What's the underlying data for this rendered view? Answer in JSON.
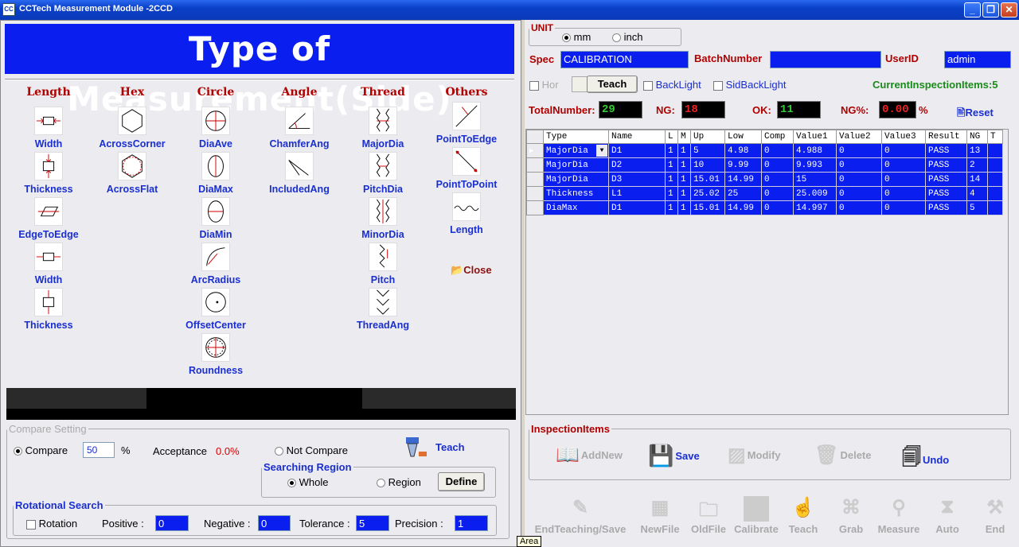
{
  "window": {
    "title": "CCTech Measurement Module -2CCD",
    "logo": "CC",
    "min": "_",
    "max": "❐",
    "close": "✕"
  },
  "banner": "Type of Measurement(Side)",
  "columns": {
    "length": {
      "head": "Length",
      "items": [
        "Width",
        "Thickness",
        "EdgeToEdge",
        "Width",
        "Thickness"
      ]
    },
    "hex": {
      "head": "Hex",
      "items": [
        "AcrossCorner",
        "AcrossFlat"
      ]
    },
    "circle": {
      "head": "Circle",
      "items": [
        "DiaAve",
        "DiaMax",
        "DiaMin",
        "ArcRadius",
        "OffsetCenter",
        "Roundness"
      ]
    },
    "angle": {
      "head": "Angle",
      "items": [
        "ChamferAng",
        "IncludedAng"
      ]
    },
    "thread": {
      "head": "Thread",
      "items": [
        "MajorDia",
        "PitchDia",
        "MinorDia",
        "Pitch",
        "ThreadAng"
      ]
    },
    "others": {
      "head": "Others",
      "items": [
        "PointToEdge",
        "PointToPoint",
        "Length"
      ]
    }
  },
  "close_label": "Close",
  "compare": {
    "legend": "Compare Setting",
    "compare_label": "Compare",
    "compare_value": "50",
    "percent": "%",
    "acceptance_label": "Acceptance",
    "acceptance_value": "0.0%",
    "not_compare_label": "Not Compare",
    "teach_label": "Teach",
    "search_legend": "Searching Region",
    "whole_label": "Whole",
    "region_label": "Region",
    "define_label": "Define"
  },
  "rotational": {
    "legend": "Rotational Search",
    "rotation_label": "Rotation",
    "positive_label": "Positive :",
    "positive_value": "0",
    "negative_label": "Negative :",
    "negative_value": "0",
    "tolerance_label": "Tolerance :",
    "tolerance_value": "5",
    "precision_label": "Precision :",
    "precision_value": "1"
  },
  "unit": {
    "legend": "UNIT",
    "mm": "mm",
    "inch": "inch"
  },
  "spec": {
    "spec_label": "Spec",
    "spec_value": "CALIBRATION",
    "batch_label": "BatchNumber",
    "batch_value": "",
    "user_label": "UserID",
    "user_value": "admin"
  },
  "options": {
    "hor": "Hor",
    "teach": "Teach",
    "backlight": "BackLight",
    "sidbacklight": "SidBackLight",
    "current": "CurrentInspectionItems:5"
  },
  "counters": {
    "total_label": "TotalNumber:",
    "total_value": "29",
    "ng_label": "NG:",
    "ng_value": "18",
    "ok_label": "OK:",
    "ok_value": "11",
    "ngp_label": "NG%:",
    "ngp_value": "0.00",
    "ngp_unit": "%",
    "reset_label": "Reset"
  },
  "table": {
    "headers": [
      "Type",
      "Name",
      "L",
      "M",
      "Up",
      "Low",
      "Comp",
      "Value1",
      "Value2",
      "Value3",
      "Result",
      "NG",
      "T"
    ],
    "rows": [
      [
        "MajorDia",
        "D1",
        "1",
        "1",
        "5",
        "4.98",
        "0",
        "4.988",
        "0",
        "0",
        "PASS",
        "13",
        ""
      ],
      [
        "MajorDia",
        "D2",
        "1",
        "1",
        "10",
        "9.99",
        "0",
        "9.993",
        "0",
        "0",
        "PASS",
        "2",
        ""
      ],
      [
        "MajorDia",
        "D3",
        "1",
        "1",
        "15.01",
        "14.99",
        "0",
        "15",
        "0",
        "0",
        "PASS",
        "14",
        ""
      ],
      [
        "Thickness",
        "L1",
        "1",
        "1",
        "25.02",
        "25",
        "0",
        "25.009",
        "0",
        "0",
        "PASS",
        "4",
        ""
      ],
      [
        "DiaMax",
        "D1",
        "1",
        "1",
        "15.01",
        "14.99",
        "0",
        "14.997",
        "0",
        "0",
        "PASS",
        "5",
        ""
      ]
    ]
  },
  "inspection": {
    "legend": "InspectionItems",
    "addnew": "AddNew",
    "save": "Save",
    "modify": "Modify",
    "delete": "Delete",
    "undo": "Undo"
  },
  "toolbar": {
    "endteach": "EndTeaching/Save",
    "newfile": "NewFile",
    "oldfile": "OldFile",
    "calibrate": "Calibrate",
    "teach": "Teach",
    "grab": "Grab",
    "measure": "Measure",
    "auto": "Auto",
    "end": "End"
  },
  "tooltip": "Area",
  "colors": {
    "banner": "#0a1ef0",
    "heading_red": "#b00000",
    "label_blue": "#1a2fd0",
    "row_blue": "#0a1ef0"
  }
}
